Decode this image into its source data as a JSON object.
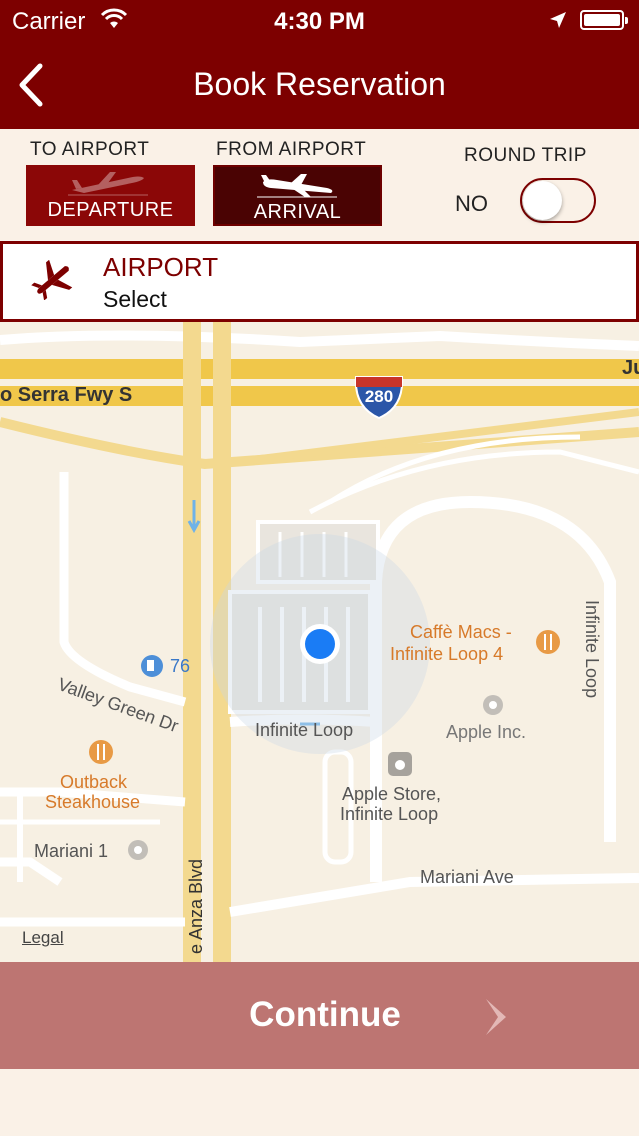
{
  "status_bar": {
    "carrier": "Carrier",
    "time": "4:30 PM"
  },
  "nav": {
    "title": "Book Reservation"
  },
  "trip_options": {
    "to_airport_label": "TO AIRPORT",
    "from_airport_label": "FROM AIRPORT",
    "departure_label": "DEPARTURE",
    "arrival_label": "ARRIVAL",
    "round_trip_label": "ROUND TRIP",
    "round_trip_value": "NO",
    "round_trip_on": false
  },
  "airport": {
    "label": "AIRPORT",
    "value": "Select"
  },
  "map": {
    "labels": {
      "freeway": "o Serra Fwy S",
      "freeway_right": "Ju",
      "highway_shield": "280",
      "gas_price": "76",
      "valley_green": "Valley Green Dr",
      "infinite_loop_road": "Infinite Loop",
      "infinite_loop_vertical": "Infinite Loop",
      "cafe_line1": "Caffè Macs -",
      "cafe_line2": "Infinite Loop 4",
      "apple_inc": "Apple Inc.",
      "apple_store_line1": "Apple Store,",
      "apple_store_line2": "Infinite Loop",
      "outback_line1": "Outback",
      "outback_line2": "Steakhouse",
      "mariani1": "Mariani 1",
      "mariani_ave": "Mariani Ave",
      "de_anza": "e Anza Blvd"
    },
    "legal": "Legal"
  },
  "continue_button": {
    "label": "Continue"
  },
  "colors": {
    "brand": "#7d0000",
    "continue_bg": "#bd7572",
    "accent_blue": "#1a7cf5",
    "poi_orange": "#e58a3a"
  },
  "icons": {
    "wifi": "wifi-icon",
    "location": "location-arrow-icon",
    "battery": "battery-icon",
    "back": "chevron-left-icon",
    "departure": "plane-departure-icon",
    "arrival": "plane-arrival-icon",
    "airport": "airplane-icon",
    "continue": "chevron-right-icon"
  }
}
